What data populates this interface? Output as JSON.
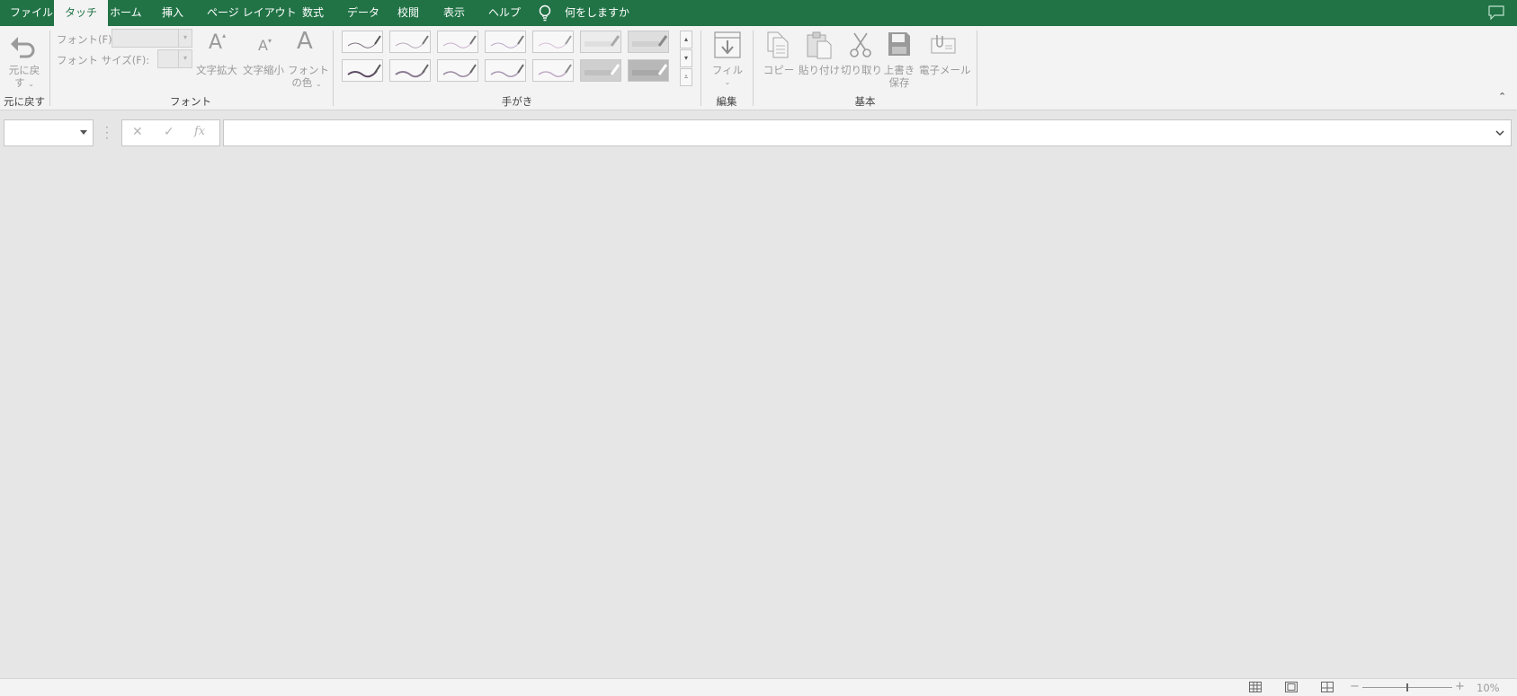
{
  "menu": {
    "tabs": [
      {
        "label": "ファイル",
        "active": false
      },
      {
        "label": "タッチ",
        "active": true
      },
      {
        "label": "ホーム",
        "active": false
      },
      {
        "label": "挿入",
        "active": false
      },
      {
        "label": "ページ レイアウト",
        "active": false
      },
      {
        "label": "数式",
        "active": false
      },
      {
        "label": "データ",
        "active": false
      },
      {
        "label": "校閲",
        "active": false
      },
      {
        "label": "表示",
        "active": false
      },
      {
        "label": "ヘルプ",
        "active": false
      }
    ],
    "tell_me": "何をしますか",
    "accent_color": "#217346"
  },
  "ribbon": {
    "undo": {
      "label_line1": "元に戻",
      "label_line2": "す",
      "group": "元に戻す"
    },
    "font": {
      "font_label": "フォント(F):",
      "size_label": "フォント サイズ(F):",
      "grow_label": "文字拡大",
      "shrink_label": "文字縮小",
      "color_line1": "フォント",
      "color_line2": "の色",
      "group": "フォント"
    },
    "ink": {
      "group": "手がき"
    },
    "edit": {
      "fill_label": "フィル",
      "group": "編集"
    },
    "basic": {
      "copy": "コピー",
      "paste": "貼り付け",
      "cut": "切り取り",
      "save_line1": "上書き",
      "save_line2": "保存",
      "email": "電子メール",
      "group": "基本"
    }
  },
  "formula_bar": {
    "namebox_value": "",
    "formula_value": "",
    "fx_label": "fx"
  },
  "status_bar": {
    "zoom": "10%",
    "zoom_level": 0.1
  }
}
